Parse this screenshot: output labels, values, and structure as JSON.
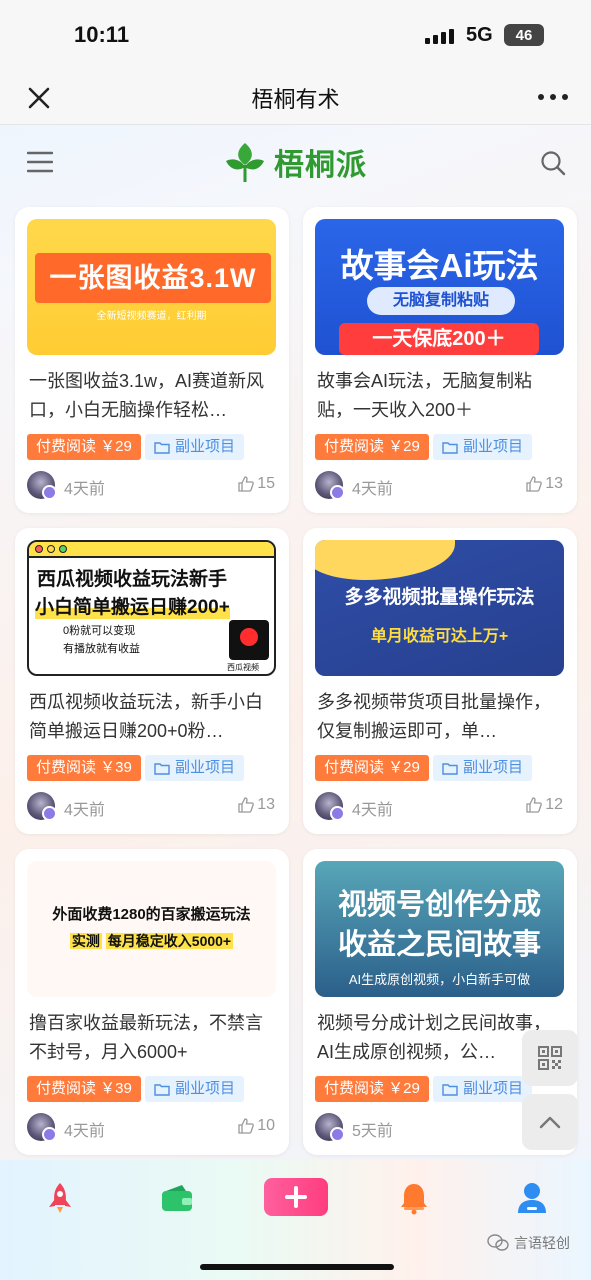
{
  "status_bar": {
    "time": "10:11",
    "network": "5G",
    "battery": "46"
  },
  "title_bar": {
    "title": "梧桐有术"
  },
  "site": {
    "logo_text": "梧桐派"
  },
  "cards": [
    {
      "thumb": {
        "headline": "一张图收益3.1W",
        "subline": "全新短视频赛道，红利期"
      },
      "title": "一张图收益3.1w，AI赛道新风口，小白无脑操作轻松…",
      "price_tag": "付费阅读 ￥29",
      "category": "副业项目",
      "time": "4天前",
      "likes": "15"
    },
    {
      "thumb": {
        "headline": "故事会Ai玩法",
        "pill": "无脑复制粘贴",
        "bar": "一天保底200＋"
      },
      "title": "故事会AI玩法，无脑复制粘贴，一天收入200＋",
      "price_tag": "付费阅读 ￥29",
      "category": "副业项目",
      "time": "4天前",
      "likes": "13"
    },
    {
      "thumb": {
        "line1": "西瓜视频收益玩法新手",
        "line2": "小白简单搬运日赚200+",
        "line3": "0粉就可以变现",
        "line4": "有播放就有收益",
        "badge": "西瓜视频"
      },
      "title": "西瓜视频收益玩法，新手小白简单搬运日赚200+0粉…",
      "price_tag": "付费阅读 ￥39",
      "category": "副业项目",
      "time": "4天前",
      "likes": "13"
    },
    {
      "thumb": {
        "line1": "多多视频批量操作玩法",
        "line2": "单月收益可达上万+"
      },
      "title": "多多视频带货项目批量操作，仅复制搬运即可，单…",
      "price_tag": "付费阅读 ￥29",
      "category": "副业项目",
      "time": "4天前",
      "likes": "12"
    },
    {
      "thumb": {
        "line1": "外面收费1280的百家搬运玩法",
        "line2_hl": "实测",
        "line2": "每月稳定收入5000+"
      },
      "title": "撸百家收益最新玩法，不禁言不封号，月入6000+",
      "price_tag": "付费阅读 ￥39",
      "category": "副业项目",
      "time": "4天前",
      "likes": "10"
    },
    {
      "thumb": {
        "line1": "视频号创作分成",
        "line2": "收益之民间故事",
        "line3": "AI生成原创视频，小白新手可做"
      },
      "title": "视频号分成计划之民间故事，AI生成原创视频，公…",
      "price_tag": "付费阅读 ￥29",
      "category": "副业项目",
      "time": "5天前",
      "likes": ""
    }
  ],
  "watermark": "言语轻创",
  "colors": {
    "paid_tag": "#ff7b3c",
    "category_tag": "#4d8fe0",
    "logo_green": "#2f9a2f",
    "plus_pink": "#ff3d7f"
  },
  "icons": [
    "close-icon",
    "more-icon",
    "menu-icon",
    "search-icon",
    "folder-icon",
    "like-icon",
    "qrcode-icon",
    "chevron-up-icon",
    "rocket-icon",
    "wallet-icon",
    "plus-icon",
    "bell-icon",
    "user-icon"
  ]
}
